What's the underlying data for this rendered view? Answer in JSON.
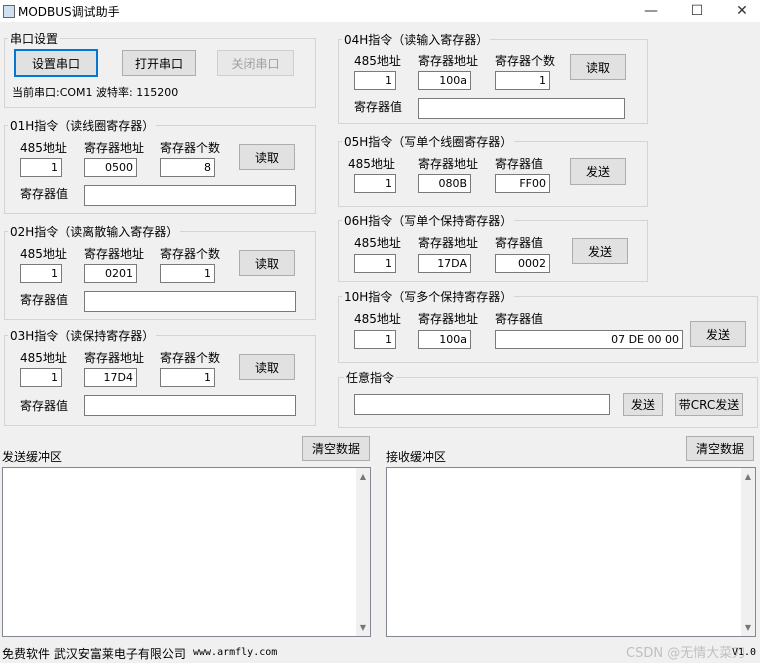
{
  "window": {
    "title": "MODBUS调试助手",
    "minimize": "—",
    "maximize": "☐",
    "close": "✕"
  },
  "serial": {
    "title": "串口设置",
    "set_btn": "设置串口",
    "open_btn": "打开串口",
    "close_btn": "关闭串口",
    "status": "当前串口:COM1 波特率: 115200"
  },
  "labels": {
    "addr485": "485地址",
    "reg_addr": "寄存器地址",
    "reg_count": "寄存器个数",
    "reg_value": "寄存器值",
    "read": "读取",
    "send": "发送"
  },
  "f01": {
    "title": "01H指令（读线圈寄存器）",
    "addr": "1",
    "reg": "0500",
    "count": "8",
    "value": ""
  },
  "f02": {
    "title": "02H指令（读离散输入寄存器）",
    "addr": "1",
    "reg": "0201",
    "count": "1",
    "value": ""
  },
  "f03": {
    "title": "03H指令（读保持寄存器）",
    "addr": "1",
    "reg": "17D4",
    "count": "1",
    "value": ""
  },
  "f04": {
    "title": "04H指令（读输入寄存器）",
    "addr": "1",
    "reg": "100a",
    "count": "1",
    "value": ""
  },
  "f05": {
    "title": "05H指令（写单个线圈寄存器）",
    "addr": "1",
    "reg": "080B",
    "value": "FF00"
  },
  "f06": {
    "title": "06H指令（写单个保持寄存器）",
    "addr": "1",
    "reg": "17DA",
    "value": "0002"
  },
  "f10": {
    "title": "10H指令（写多个保持寄存器）",
    "addr": "1",
    "reg": "100a",
    "value": "07 DE  00 00"
  },
  "any": {
    "title": "任意指令",
    "value": "",
    "send": "发送",
    "crc_send": "带CRC发送"
  },
  "send_buffer": {
    "label": "发送缓冲区",
    "clear": "清空数据",
    "content": ""
  },
  "recv_buffer": {
    "label": "接收缓冲区",
    "clear": "清空数据",
    "content": ""
  },
  "footer": {
    "text": "免费软件 武汉安富莱电子有限公司",
    "url": "www.armfly.com",
    "version": "V1.0",
    "watermark": "CSDN @无情大菜刀"
  }
}
